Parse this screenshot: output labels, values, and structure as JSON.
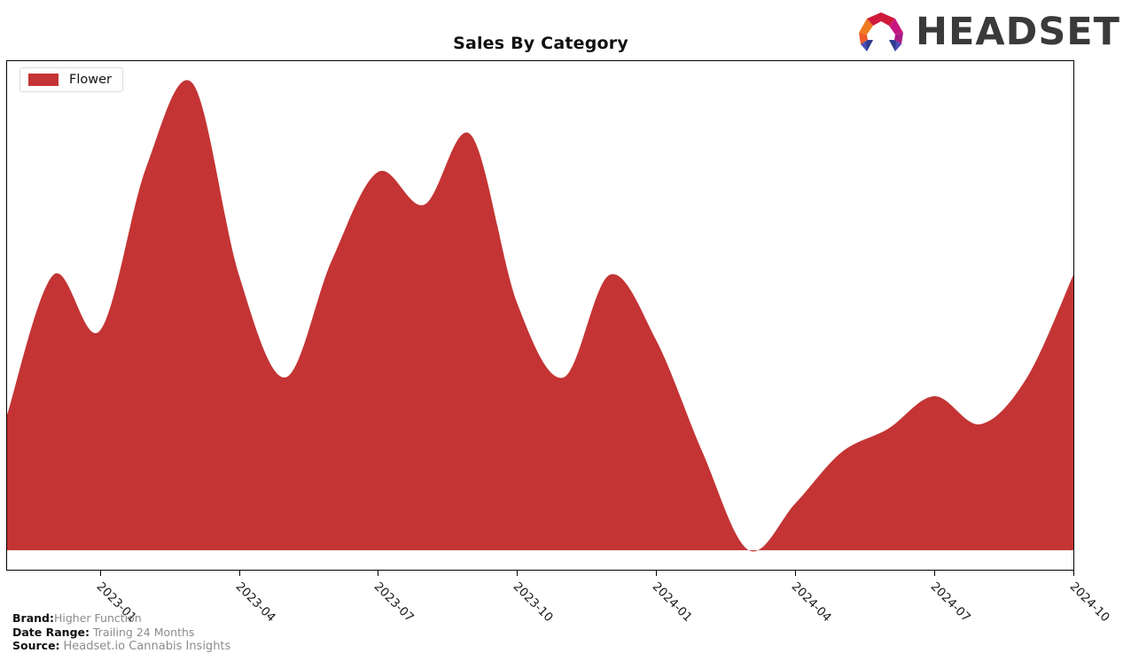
{
  "header": {
    "title": "Sales By Category",
    "logo_text": "HEADSET",
    "logo_icon": "headset-arch-logo"
  },
  "legend": {
    "position": "top-left",
    "entries": [
      {
        "label": "Flower",
        "color": "#c43434"
      }
    ]
  },
  "footer": {
    "brand_key": "Brand:",
    "brand_value": "Higher Function",
    "date_range_key": "Date Range:",
    "date_range_value": "Trailing 24 Months",
    "source_key": "Source:",
    "source_value": "Headset.io Cannabis Insights"
  },
  "colors": {
    "series_fill": "#c43434",
    "axis": "#000000",
    "plot_background": "#ffffff",
    "title_text": "#111111",
    "footer_value_text": "#8c8c8c"
  },
  "chart_data": {
    "type": "area",
    "title": "Sales By Category",
    "xlabel": "",
    "ylabel": "",
    "grid": false,
    "legend_position": "top-left",
    "smoothing": "spline",
    "axis_tick_labels": [
      "2023-01",
      "2023-04",
      "2023-07",
      "2023-10",
      "2024-01",
      "2024-04",
      "2024-07",
      "2024-10"
    ],
    "x": [
      "2022-11",
      "2022-12",
      "2023-01",
      "2023-02",
      "2023-03",
      "2023-04",
      "2023-05",
      "2023-06",
      "2023-07",
      "2023-08",
      "2023-09",
      "2023-10",
      "2023-11",
      "2023-12",
      "2024-01",
      "2024-02",
      "2024-03",
      "2024-04",
      "2024-05",
      "2024-06",
      "2024-07",
      "2024-08",
      "2024-09",
      "2024-10"
    ],
    "ylim": [
      0,
      100
    ],
    "series": [
      {
        "name": "Flower",
        "color": "#c43434",
        "values": [
          29,
          59,
          47,
          82,
          100,
          59,
          37,
          62,
          81,
          74,
          89,
          53,
          37,
          59,
          45,
          21,
          0,
          10,
          21,
          26,
          33,
          27,
          37,
          59
        ]
      }
    ]
  }
}
